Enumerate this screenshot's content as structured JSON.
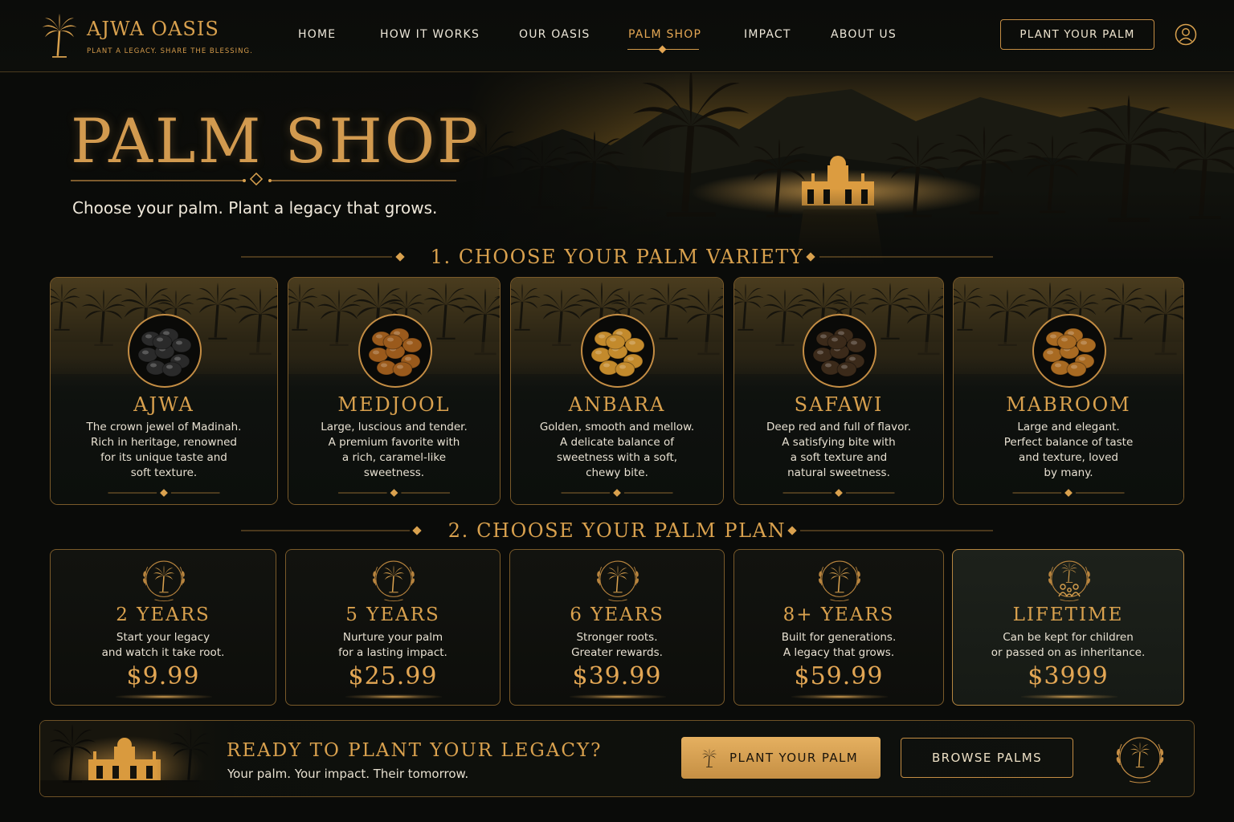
{
  "brand": {
    "name": "AJWA OASIS",
    "tagline": "PLANT A LEGACY. SHARE THE BLESSING."
  },
  "nav": {
    "items": [
      {
        "label": "HOME"
      },
      {
        "label": "HOW IT WORKS"
      },
      {
        "label": "OUR OASIS"
      },
      {
        "label": "PALM SHOP",
        "active": true
      },
      {
        "label": "IMPACT"
      },
      {
        "label": "ABOUT US"
      }
    ],
    "cta_label": "PLANT YOUR PALM",
    "user_icon": "user-icon"
  },
  "hero": {
    "title": "PALM SHOP",
    "subtitle": "Choose your palm. Plant a legacy that grows."
  },
  "varieties": {
    "heading": "1. CHOOSE YOUR PALM VARIETY",
    "items": [
      {
        "name": "AJWA",
        "desc": [
          "The crown jewel of Madinah.",
          "Rich in heritage, renowned",
          "for its unique taste and",
          "soft texture."
        ],
        "date_color": "#2a2a2a"
      },
      {
        "name": "MEDJOOL",
        "desc": [
          "Large, luscious and tender.",
          "A premium favorite with",
          "a rich, caramel-like",
          "sweetness."
        ],
        "date_color": "#9a5a1c"
      },
      {
        "name": "ANBARA",
        "desc": [
          "Golden, smooth and mellow.",
          "A delicate balance of",
          "sweetness with a soft,",
          "chewy bite."
        ],
        "date_color": "#c38a2c"
      },
      {
        "name": "SAFAWI",
        "desc": [
          "Deep red and full of flavor.",
          "A satisfying bite with",
          "a soft texture and",
          "natural sweetness."
        ],
        "date_color": "#3b2a1a"
      },
      {
        "name": "MABROOM",
        "desc": [
          "Large and elegant.",
          "Perfect balance of taste",
          "and texture, loved",
          "by many."
        ],
        "date_color": "#a86a22"
      }
    ]
  },
  "plans": {
    "heading": "2. CHOOSE YOUR PALM PLAN",
    "items": [
      {
        "title": "2 YEARS",
        "desc": [
          "Start your legacy",
          "and watch it take root."
        ],
        "price": "$9.99"
      },
      {
        "title": "5 YEARS",
        "desc": [
          "Nurture your palm",
          "for a lasting impact."
        ],
        "price": "$25.99"
      },
      {
        "title": "6 YEARS",
        "desc": [
          "Stronger roots.",
          "Greater rewards."
        ],
        "price": "$39.99"
      },
      {
        "title": "8+ YEARS",
        "desc": [
          "Built for generations.",
          "A legacy that grows."
        ],
        "price": "$59.99"
      },
      {
        "title": "LIFETIME",
        "desc": [
          "Can be kept for children",
          "or passed on as inheritance."
        ],
        "price": "$3999"
      }
    ]
  },
  "banner": {
    "title": "READY TO PLANT YOUR LEGACY?",
    "subtitle": "Your palm. Your impact. Their tomorrow.",
    "primary_label": "PLANT YOUR PALM",
    "secondary_label": "BROWSE PALMS"
  },
  "colors": {
    "gold": "#d9a14e",
    "background": "#0a0b09",
    "button_gold": "#e5b060"
  }
}
